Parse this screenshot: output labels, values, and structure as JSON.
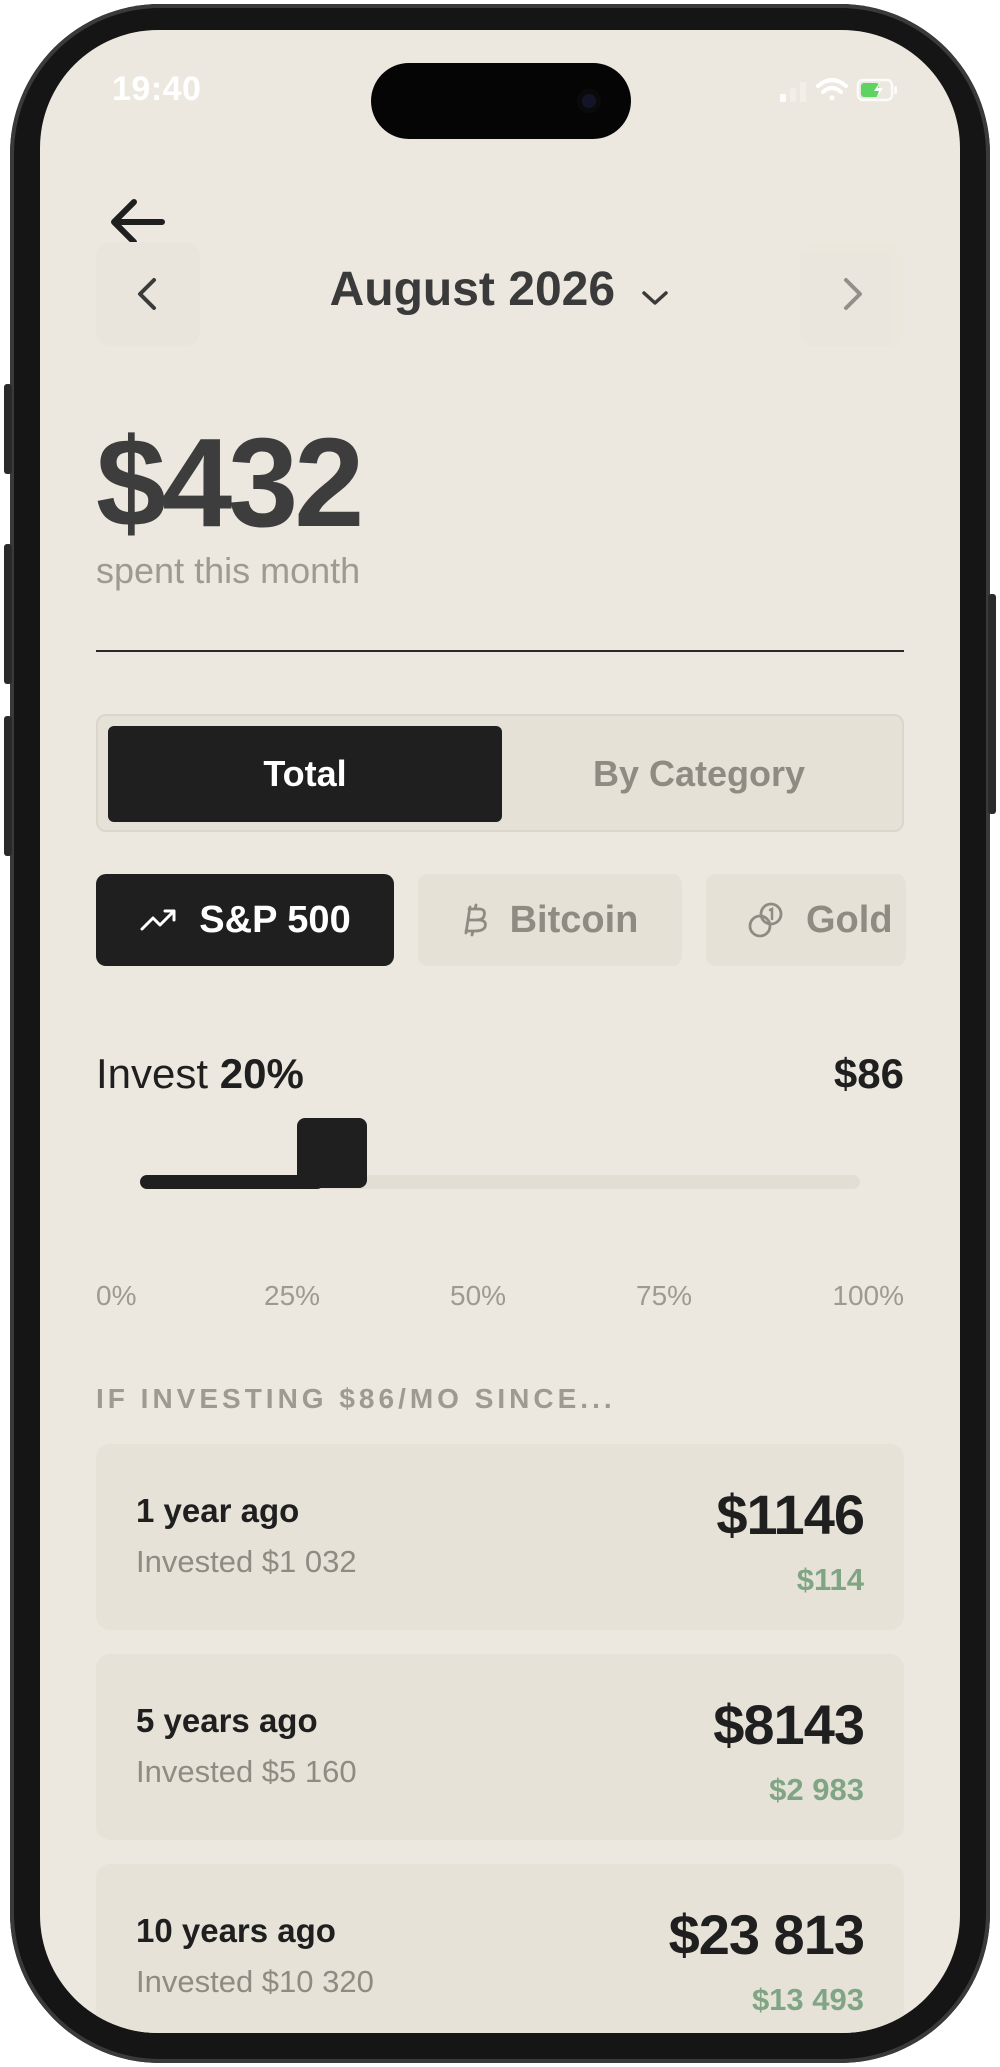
{
  "status": {
    "time": "19:40"
  },
  "header": {
    "month": "August 2026"
  },
  "summary": {
    "amount": "$432",
    "label": "spent this month"
  },
  "view_toggle": {
    "total_label": "Total",
    "category_label": "By Category",
    "selected": "Total"
  },
  "assets": {
    "selected": "S&P 500",
    "items": [
      {
        "label": "S&P 500",
        "icon": "trending-up-icon"
      },
      {
        "label": "Bitcoin",
        "icon": "bitcoin-icon"
      },
      {
        "label": "Gold",
        "icon": "coins-icon"
      }
    ]
  },
  "invest": {
    "label": "Invest",
    "percent_label": "20%",
    "percent_value": 20,
    "amount": "$86",
    "ticks": [
      "0%",
      "25%",
      "50%",
      "75%",
      "100%"
    ]
  },
  "projection": {
    "title": "IF INVESTING $86/MO SINCE...",
    "rows": [
      {
        "period": "1 year ago",
        "invested": "Invested $1 032",
        "value": "$1146",
        "gain": "$114"
      },
      {
        "period": "5 years ago",
        "invested": "Invested $5 160",
        "value": "$8143",
        "gain": "$2 983"
      },
      {
        "period": "10 years ago",
        "invested": "Invested $10 320",
        "value": "$23 813",
        "gain": "$13 493"
      }
    ]
  },
  "colors": {
    "background": "#ece8df",
    "accent": "#1f1f1f",
    "gain": "#7fa585"
  }
}
